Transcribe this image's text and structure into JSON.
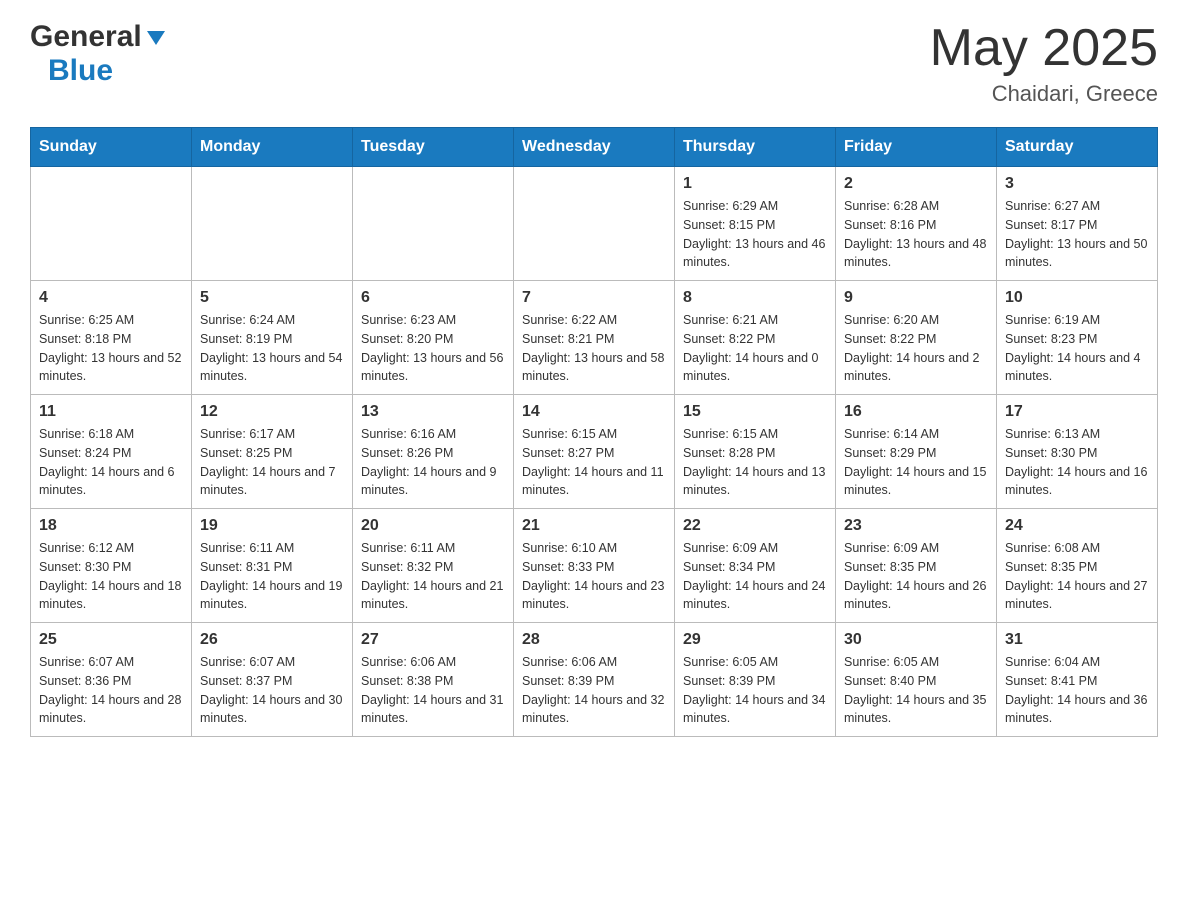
{
  "header": {
    "logo_general": "General",
    "logo_blue": "Blue",
    "month_title": "May 2025",
    "location": "Chaidari, Greece"
  },
  "days_of_week": [
    "Sunday",
    "Monday",
    "Tuesday",
    "Wednesday",
    "Thursday",
    "Friday",
    "Saturday"
  ],
  "weeks": [
    [
      {
        "day": "",
        "info": ""
      },
      {
        "day": "",
        "info": ""
      },
      {
        "day": "",
        "info": ""
      },
      {
        "day": "",
        "info": ""
      },
      {
        "day": "1",
        "info": "Sunrise: 6:29 AM\nSunset: 8:15 PM\nDaylight: 13 hours and 46 minutes."
      },
      {
        "day": "2",
        "info": "Sunrise: 6:28 AM\nSunset: 8:16 PM\nDaylight: 13 hours and 48 minutes."
      },
      {
        "day": "3",
        "info": "Sunrise: 6:27 AM\nSunset: 8:17 PM\nDaylight: 13 hours and 50 minutes."
      }
    ],
    [
      {
        "day": "4",
        "info": "Sunrise: 6:25 AM\nSunset: 8:18 PM\nDaylight: 13 hours and 52 minutes."
      },
      {
        "day": "5",
        "info": "Sunrise: 6:24 AM\nSunset: 8:19 PM\nDaylight: 13 hours and 54 minutes."
      },
      {
        "day": "6",
        "info": "Sunrise: 6:23 AM\nSunset: 8:20 PM\nDaylight: 13 hours and 56 minutes."
      },
      {
        "day": "7",
        "info": "Sunrise: 6:22 AM\nSunset: 8:21 PM\nDaylight: 13 hours and 58 minutes."
      },
      {
        "day": "8",
        "info": "Sunrise: 6:21 AM\nSunset: 8:22 PM\nDaylight: 14 hours and 0 minutes."
      },
      {
        "day": "9",
        "info": "Sunrise: 6:20 AM\nSunset: 8:22 PM\nDaylight: 14 hours and 2 minutes."
      },
      {
        "day": "10",
        "info": "Sunrise: 6:19 AM\nSunset: 8:23 PM\nDaylight: 14 hours and 4 minutes."
      }
    ],
    [
      {
        "day": "11",
        "info": "Sunrise: 6:18 AM\nSunset: 8:24 PM\nDaylight: 14 hours and 6 minutes."
      },
      {
        "day": "12",
        "info": "Sunrise: 6:17 AM\nSunset: 8:25 PM\nDaylight: 14 hours and 7 minutes."
      },
      {
        "day": "13",
        "info": "Sunrise: 6:16 AM\nSunset: 8:26 PM\nDaylight: 14 hours and 9 minutes."
      },
      {
        "day": "14",
        "info": "Sunrise: 6:15 AM\nSunset: 8:27 PM\nDaylight: 14 hours and 11 minutes."
      },
      {
        "day": "15",
        "info": "Sunrise: 6:15 AM\nSunset: 8:28 PM\nDaylight: 14 hours and 13 minutes."
      },
      {
        "day": "16",
        "info": "Sunrise: 6:14 AM\nSunset: 8:29 PM\nDaylight: 14 hours and 15 minutes."
      },
      {
        "day": "17",
        "info": "Sunrise: 6:13 AM\nSunset: 8:30 PM\nDaylight: 14 hours and 16 minutes."
      }
    ],
    [
      {
        "day": "18",
        "info": "Sunrise: 6:12 AM\nSunset: 8:30 PM\nDaylight: 14 hours and 18 minutes."
      },
      {
        "day": "19",
        "info": "Sunrise: 6:11 AM\nSunset: 8:31 PM\nDaylight: 14 hours and 19 minutes."
      },
      {
        "day": "20",
        "info": "Sunrise: 6:11 AM\nSunset: 8:32 PM\nDaylight: 14 hours and 21 minutes."
      },
      {
        "day": "21",
        "info": "Sunrise: 6:10 AM\nSunset: 8:33 PM\nDaylight: 14 hours and 23 minutes."
      },
      {
        "day": "22",
        "info": "Sunrise: 6:09 AM\nSunset: 8:34 PM\nDaylight: 14 hours and 24 minutes."
      },
      {
        "day": "23",
        "info": "Sunrise: 6:09 AM\nSunset: 8:35 PM\nDaylight: 14 hours and 26 minutes."
      },
      {
        "day": "24",
        "info": "Sunrise: 6:08 AM\nSunset: 8:35 PM\nDaylight: 14 hours and 27 minutes."
      }
    ],
    [
      {
        "day": "25",
        "info": "Sunrise: 6:07 AM\nSunset: 8:36 PM\nDaylight: 14 hours and 28 minutes."
      },
      {
        "day": "26",
        "info": "Sunrise: 6:07 AM\nSunset: 8:37 PM\nDaylight: 14 hours and 30 minutes."
      },
      {
        "day": "27",
        "info": "Sunrise: 6:06 AM\nSunset: 8:38 PM\nDaylight: 14 hours and 31 minutes."
      },
      {
        "day": "28",
        "info": "Sunrise: 6:06 AM\nSunset: 8:39 PM\nDaylight: 14 hours and 32 minutes."
      },
      {
        "day": "29",
        "info": "Sunrise: 6:05 AM\nSunset: 8:39 PM\nDaylight: 14 hours and 34 minutes."
      },
      {
        "day": "30",
        "info": "Sunrise: 6:05 AM\nSunset: 8:40 PM\nDaylight: 14 hours and 35 minutes."
      },
      {
        "day": "31",
        "info": "Sunrise: 6:04 AM\nSunset: 8:41 PM\nDaylight: 14 hours and 36 minutes."
      }
    ]
  ]
}
